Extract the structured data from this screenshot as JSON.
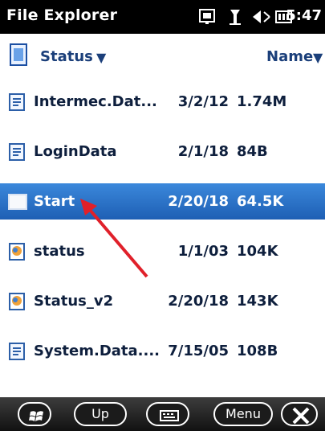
{
  "status_bar": {
    "title": "File Explorer",
    "time": "5:47",
    "icons": [
      "network-icon",
      "signal-icon",
      "volume-muted-icon",
      "battery-icon"
    ]
  },
  "header": {
    "folder": "Status",
    "sort_label": "Name"
  },
  "files": [
    {
      "name": "Intermec.Dat...",
      "date": "3/2/12",
      "size": "1.74M",
      "icon": "document-icon",
      "selected": false
    },
    {
      "name": "LoginData",
      "date": "2/1/18",
      "size": "84B",
      "icon": "document-icon",
      "selected": false
    },
    {
      "name": "Start",
      "date": "2/20/18",
      "size": "64.5K",
      "icon": "blank-file-icon",
      "selected": true
    },
    {
      "name": "status",
      "date": "1/1/03",
      "size": "104K",
      "icon": "app-icon",
      "selected": false
    },
    {
      "name": "Status_v2",
      "date": "2/20/18",
      "size": "143K",
      "icon": "app-icon",
      "selected": false
    },
    {
      "name": "System.Data....",
      "date": "7/15/05",
      "size": "108B",
      "icon": "document-icon",
      "selected": false
    }
  ],
  "bottom_bar": {
    "up_label": "Up",
    "menu_label": "Menu"
  },
  "colors": {
    "status_bar_bg": "#000000",
    "selection": "#2f76cf",
    "text": "#0e1f3d",
    "annotation_arrow": "#e0202a"
  }
}
